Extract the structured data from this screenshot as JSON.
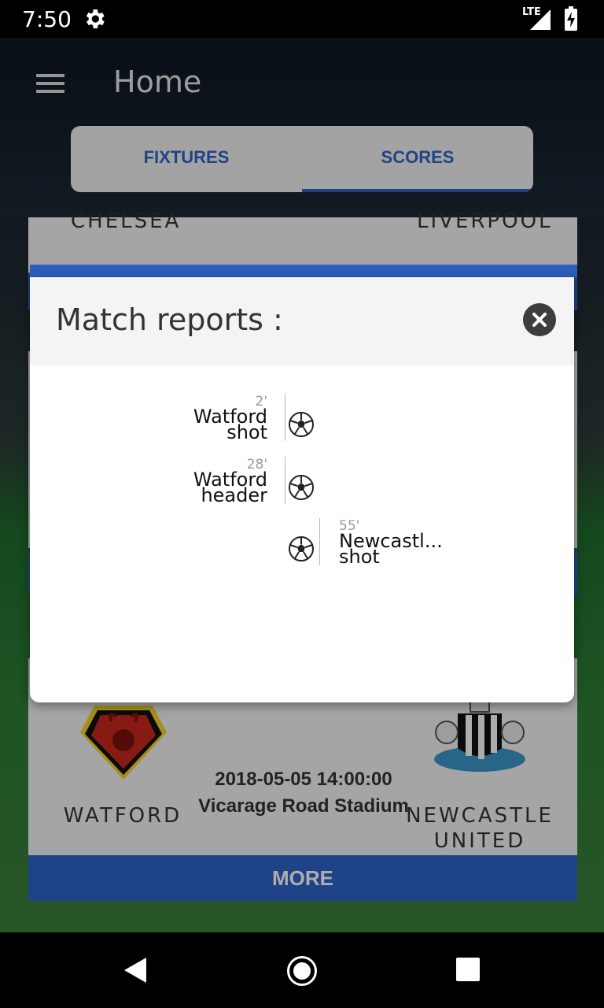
{
  "status_bar": {
    "time": "7:50",
    "network": "LTE"
  },
  "header": {
    "title": "Home"
  },
  "tabs": [
    {
      "label": "FIXTURES"
    },
    {
      "label": "SCORES"
    }
  ],
  "top_card": {
    "home_team": "CHELSEA",
    "away_team": "LIVERPOOL"
  },
  "bottom_card": {
    "home_team": "WATFORD",
    "away_team_line1": "NEWCASTLE",
    "away_team_line2": "UNITED",
    "datetime": "2018-05-05 14:00:00",
    "venue": "Vicarage Road Stadium",
    "more_label": "MORE"
  },
  "dialog": {
    "title": "Match reports :",
    "events": [
      {
        "minute": "2'",
        "team": "Watford",
        "type": "shot",
        "side": "home"
      },
      {
        "minute": "28'",
        "team": "Watford",
        "type": "header",
        "side": "home"
      },
      {
        "minute": "55'",
        "team": "Newcastl...",
        "type": "shot",
        "side": "away"
      }
    ]
  },
  "colors": {
    "accent": "#2e64c8",
    "tab_bg": "#f1f1f1",
    "dialog_header_bg": "#f4f4f4"
  }
}
